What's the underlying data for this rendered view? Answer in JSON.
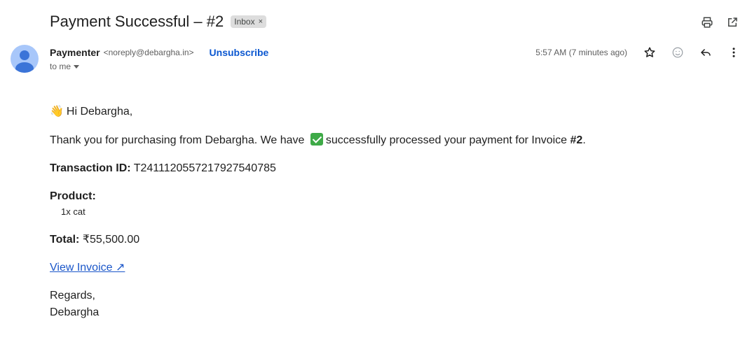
{
  "email": {
    "subject": "Payment Successful – #2",
    "label": "Inbox",
    "label_remove": "×",
    "sender": {
      "name": "Paymenter",
      "email": "<noreply@debargha.in>",
      "unsubscribe": "Unsubscribe"
    },
    "recipient": "to me",
    "timestamp": "5:57 AM (7 minutes ago)"
  },
  "body": {
    "greeting_emoji": "👋",
    "greeting": "Hi Debargha,",
    "thanks_pre": "Thank you for purchasing from Debargha. We have",
    "thanks_post": "successfully processed your payment for Invoice",
    "invoice_number": "#2",
    "period": ".",
    "transaction_label": "Transaction ID:",
    "transaction_id": "T2411120557217927540785",
    "product_label": "Product:",
    "product_item": "1x cat",
    "total_label": "Total:",
    "total_value": "₹55,500.00",
    "view_invoice": "View Invoice ↗",
    "regards": "Regards,",
    "signature": "Debargha"
  },
  "icons": {
    "print": "print-icon",
    "open_new_window": "open-in-new-icon",
    "star": "star-icon",
    "emoji": "emoji-icon",
    "reply": "reply-icon",
    "more": "more-vert-icon"
  }
}
